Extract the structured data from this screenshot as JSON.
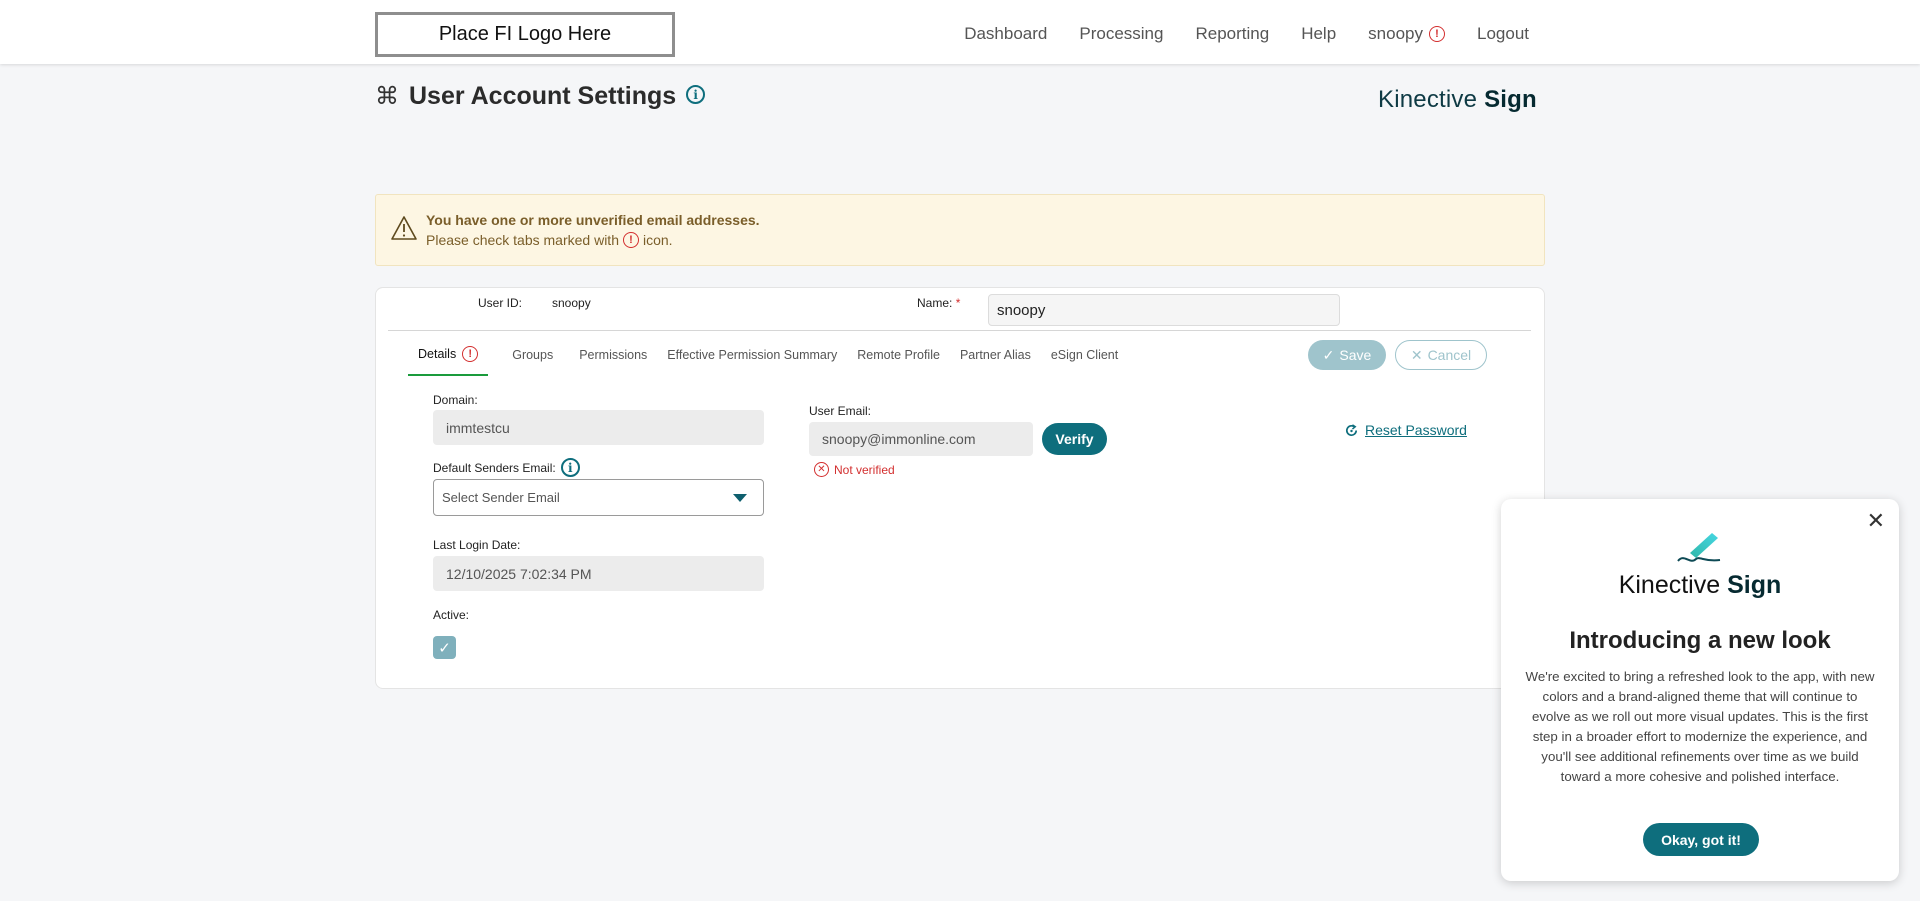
{
  "header": {
    "logo_text": "Place FI Logo Here",
    "nav": {
      "dashboard": "Dashboard",
      "processing": "Processing",
      "reporting": "Reporting",
      "help": "Help",
      "user": "snoopy",
      "logout": "Logout"
    }
  },
  "page": {
    "title": "User Account Settings",
    "brand_light": "Kinective",
    "brand_bold": "Sign"
  },
  "alert": {
    "title": "You have one or more unverified email addresses.",
    "text_before": "Please check tabs marked with",
    "text_after": "icon."
  },
  "user": {
    "id_label": "User ID:",
    "id_value": "snoopy",
    "name_label": "Name:",
    "name_required": "*",
    "name_value": "snoopy"
  },
  "tabs": [
    {
      "label": "Details",
      "active": true,
      "warning": true
    },
    {
      "label": "Groups"
    },
    {
      "label": "Permissions"
    },
    {
      "label": "Effective Permission Summary"
    },
    {
      "label": "Remote Profile"
    },
    {
      "label": "Partner Alias"
    },
    {
      "label": "eSign Client"
    }
  ],
  "actions": {
    "save": "Save",
    "cancel": "Cancel"
  },
  "details": {
    "domain_label": "Domain:",
    "domain_value": "immtestcu",
    "default_senders_label": "Default Senders Email:",
    "select_placeholder": "Select Sender Email",
    "last_login_label": "Last Login Date:",
    "last_login_value": "12/10/2025 7:02:34 PM",
    "active_label": "Active:",
    "active_checked": true,
    "user_email_label": "User Email:",
    "user_email_value": "snoopy@immonline.com",
    "verify_label": "Verify",
    "not_verified": "Not verified",
    "reset_password": "Reset Password"
  },
  "popup": {
    "brand_light": "Kinective",
    "brand_bold": "Sign",
    "title": "Introducing a new look",
    "body": "We're excited to bring a refreshed look to the app, with new colors and a brand-aligned theme that will continue to evolve as we roll out more visual updates. This is the first step in a broader effort to modernize the experience, and you'll see additional refinements over time as we build toward a more cohesive and polished interface.",
    "button": "Okay, got it!"
  },
  "colors": {
    "accent": "#0e6e7d",
    "error": "#d32f2f",
    "alert_bg": "#fdf6e3",
    "active_tab_underline": "#1a9b3c"
  }
}
